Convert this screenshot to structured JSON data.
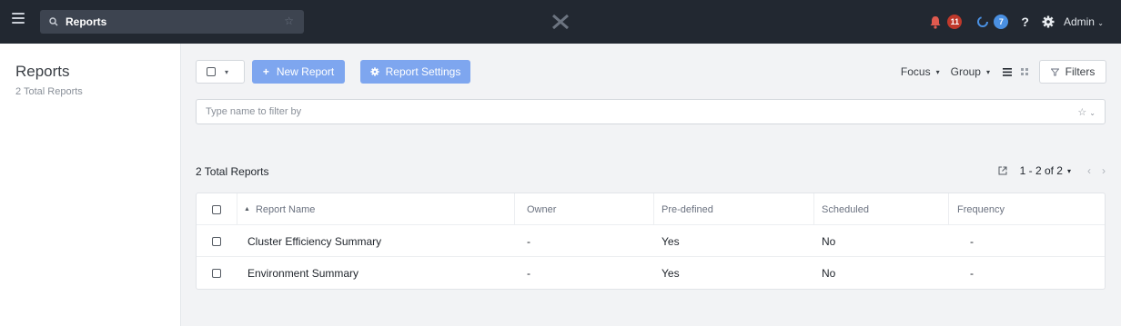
{
  "topbar": {
    "search_text": "Reports",
    "alerts_count": "11",
    "tasks_count": "7",
    "help_label": "?",
    "user_label": "Admin"
  },
  "sidebar": {
    "title": "Reports",
    "subtitle": "2 Total Reports"
  },
  "toolbar": {
    "new_report_label": "New Report",
    "report_settings_label": "Report Settings",
    "focus_label": "Focus",
    "group_label": "Group",
    "filters_label": "Filters"
  },
  "filter": {
    "placeholder": "Type name to filter by"
  },
  "list": {
    "total_label": "2 Total Reports",
    "pagination": "1 - 2 of 2"
  },
  "table": {
    "columns": [
      "Report Name",
      "Owner",
      "Pre-defined",
      "Scheduled",
      "Frequency"
    ],
    "rows": [
      [
        "Cluster Efficiency Summary",
        "-",
        "Yes",
        "No",
        "-"
      ],
      [
        "Environment Summary",
        "-",
        "Yes",
        "No",
        "-"
      ]
    ]
  },
  "colors": {
    "topbar_bg": "#222831",
    "primary_button": "#7ea6ef",
    "alert_badge": "#c0392b",
    "task_badge": "#4a90e2"
  },
  "icons": [
    "hamburger-icon",
    "search-icon",
    "star-icon",
    "logo-icon",
    "bell-icon",
    "tasks-icon",
    "help-icon",
    "gear-icon",
    "plus-icon",
    "gear-small-icon",
    "list-view-icon",
    "grid-view-icon",
    "filter-icon",
    "export-icon",
    "chevron-left-icon",
    "chevron-right-icon",
    "sort-asc-icon"
  ]
}
